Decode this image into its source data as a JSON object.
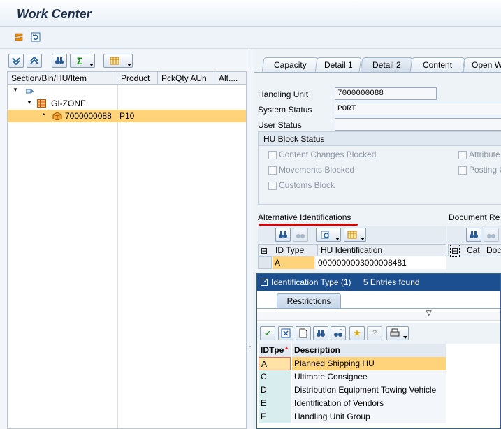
{
  "window": {
    "title": "Work Center"
  },
  "tree": {
    "columns": [
      "Section/Bin/HU/Item",
      "Product",
      "PckQty AUn",
      "Alt...."
    ],
    "rows": [
      {
        "label": "GI-ZONE",
        "product": ""
      },
      {
        "label": "7000000088",
        "product": "P10"
      }
    ]
  },
  "tabs": [
    "Capacity",
    "Detail 1",
    "Detail 2",
    "Content",
    "Open W"
  ],
  "detail": {
    "handling_unit_label": "Handling Unit",
    "handling_unit_value": "7000000088",
    "system_status_label": "System Status",
    "system_status_value": "PORT",
    "user_status_label": "User Status",
    "user_status_value": ""
  },
  "block_status": {
    "title": "HU Block Status",
    "items": [
      "Content Changes Blocked",
      "Movements Blocked",
      "Customs Block",
      "Attribute",
      "Posting C"
    ]
  },
  "alt_ids": {
    "title": "Alternative Identifications",
    "doc_title": "Document Re",
    "columns": [
      "ID Type",
      "HU Identification"
    ],
    "row": {
      "id_type": "A",
      "hu_identification": "0000000003000008481"
    },
    "doc_columns": [
      "Cat",
      "Docu"
    ]
  },
  "popup": {
    "title": "Identification Type (1)",
    "entries_found": "5 Entries found",
    "restrictions_tab": "Restrictions",
    "columns": [
      "IDTpe",
      "Description"
    ],
    "rows": [
      {
        "code": "A",
        "description": "Planned Shipping HU"
      },
      {
        "code": "C",
        "description": "Ultimate Consignee"
      },
      {
        "code": "D",
        "description": "Distribution Equipment Towing Vehicle"
      },
      {
        "code": "E",
        "description": "Identification of Vendors"
      },
      {
        "code": "F",
        "description": "Handling Unit Group"
      }
    ]
  },
  "colors": {
    "popup_title_bg": "#1b4f8f",
    "selection": "#ffd37a",
    "accent_red": "#e00000"
  }
}
